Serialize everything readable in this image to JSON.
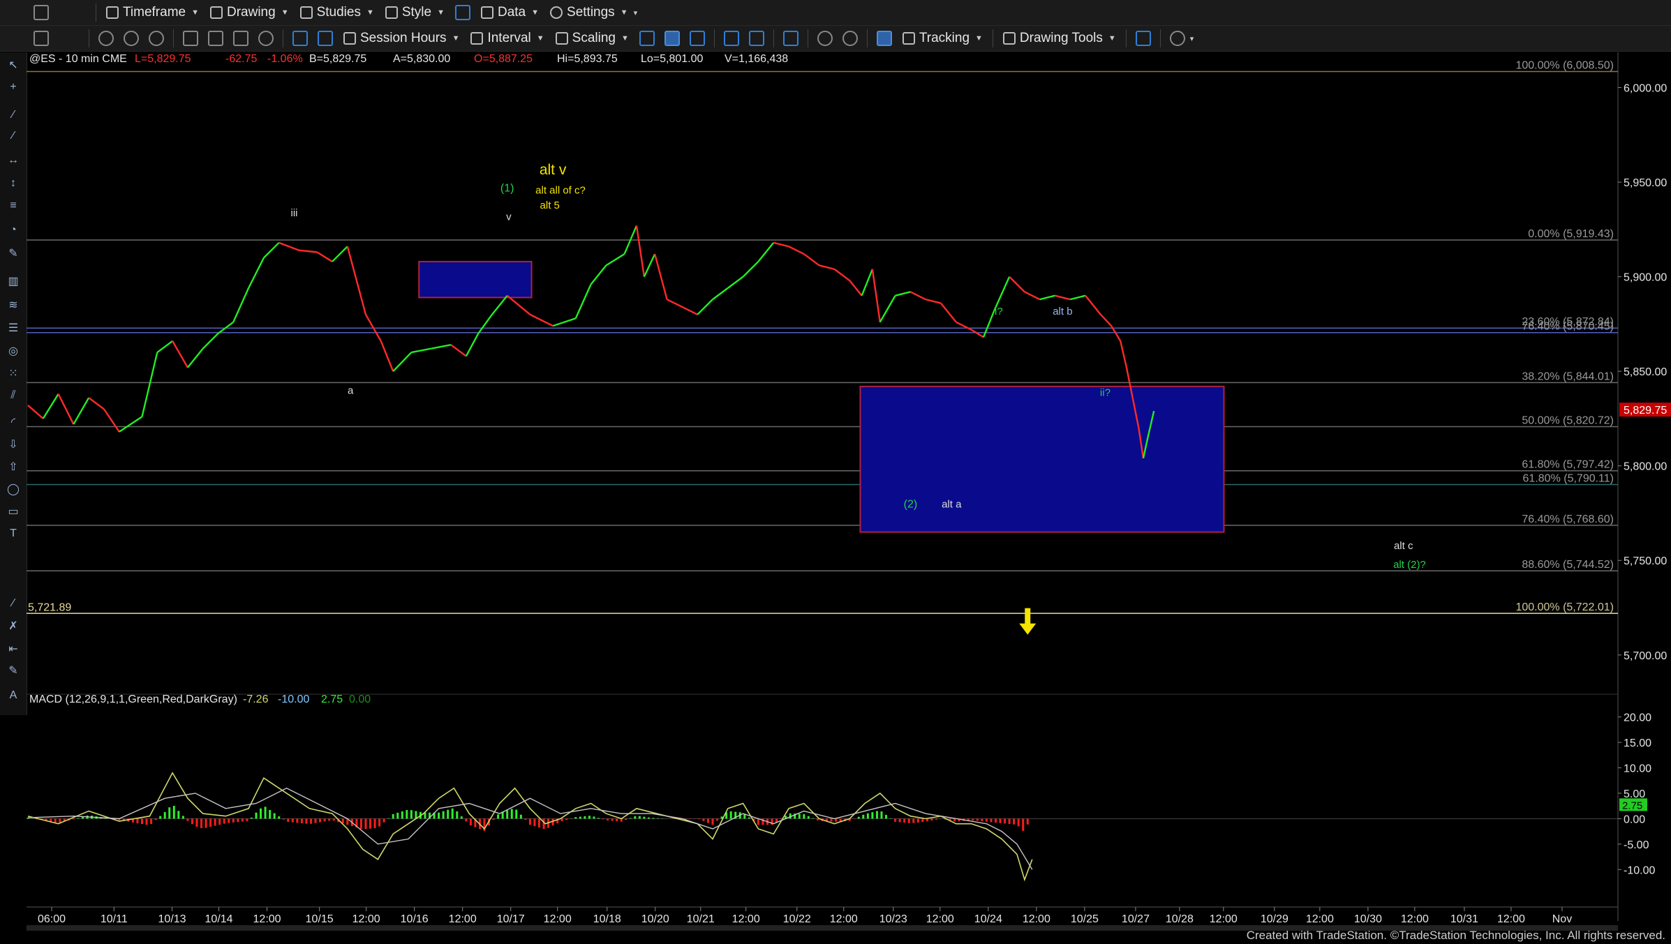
{
  "toolbar_top": {
    "items": [
      {
        "label": "Timeframe"
      },
      {
        "label": "Drawing"
      },
      {
        "label": "Studies"
      },
      {
        "label": "Style"
      },
      {
        "label": "Data"
      },
      {
        "label": "Settings"
      }
    ]
  },
  "toolbar_second": {
    "session_hours": "Session Hours",
    "interval": "Interval",
    "scaling": "Scaling",
    "tracking": "Tracking",
    "drawing_tools": "Drawing Tools"
  },
  "status_line": {
    "symbol": "@ES - 10 min  CME",
    "last": "L=5,829.75",
    "net_change": "-62.75",
    "pct_change": "-1.06%",
    "bid": "B=5,829.75",
    "ask": "A=5,830.00",
    "open": "O=5,887.25",
    "high": "Hi=5,893.75",
    "low": "Lo=5,801.00",
    "volume": "V=1,166,438"
  },
  "macd_line": {
    "label": "MACD (12,26,9,1,1,Green,Red,DarkGray)",
    "macd": "-7.26",
    "signal": "-10.00",
    "hist": "2.75",
    "zero": "0.00"
  },
  "colors": {
    "up": "#22ee22",
    "down": "#ff2a2a",
    "price_box": "#0a0a8c",
    "price_box_border": "#b02040",
    "last_price_tag": "#c80000",
    "macd_hist_pos": "#2ef02e",
    "macd_hist_neg": "#ff1c1c",
    "macd_line": "#cfd86a",
    "signal_line": "#c8c8c8",
    "fib_line": "#6a6a6a",
    "yellow": "#f5e400",
    "green_label": "#21d34a",
    "blue_label": "#4a8ff0"
  },
  "chart_data": {
    "type": "candlestick",
    "symbol": "@ES",
    "interval": "10 min",
    "y_axis_price": {
      "ylim": [
        5680,
        6012
      ],
      "ticks": [
        "6,000.00",
        "5,950.00",
        "5,900.00",
        "5,850.00",
        "5,800.00",
        "5,750.00",
        "5,700.00"
      ],
      "tick_values": [
        6000,
        5950,
        5900,
        5850,
        5800,
        5750,
        5700
      ]
    },
    "last_price_tag": {
      "label": "5,829.75",
      "value": 5829.75
    },
    "left_level": {
      "label": "5,721.89",
      "value": 5721.89
    },
    "x_axis": {
      "ticks": [
        "06:00",
        "10/11",
        "10/13",
        "10/14",
        "12:00",
        "10/15",
        "12:00",
        "10/16",
        "12:00",
        "10/17",
        "12:00",
        "10/18",
        "10/20",
        "10/21",
        "12:00",
        "10/22",
        "12:00",
        "10/23",
        "12:00",
        "10/24",
        "12:00",
        "10/25",
        "10/27",
        "10/28",
        "12:00",
        "10/29",
        "12:00",
        "10/30",
        "12:00",
        "10/31",
        "12:00",
        "Nov"
      ],
      "tick_positions": [
        0.0,
        0.044,
        0.085,
        0.118,
        0.152,
        0.189,
        0.222,
        0.256,
        0.29,
        0.324,
        0.357,
        0.392,
        0.426,
        0.458,
        0.49,
        0.526,
        0.559,
        0.594,
        0.627,
        0.661,
        0.695,
        0.729,
        0.765,
        0.796,
        0.827,
        0.863,
        0.895,
        0.929,
        0.962,
        0.997,
        1.03,
        1.066
      ]
    },
    "price_path": [
      [
        0.0,
        5832
      ],
      [
        0.01,
        5825
      ],
      [
        0.02,
        5838
      ],
      [
        0.03,
        5822
      ],
      [
        0.04,
        5836
      ],
      [
        0.05,
        5830
      ],
      [
        0.06,
        5818
      ],
      [
        0.075,
        5826
      ],
      [
        0.085,
        5860
      ],
      [
        0.095,
        5866
      ],
      [
        0.105,
        5852
      ],
      [
        0.115,
        5862
      ],
      [
        0.125,
        5870
      ],
      [
        0.135,
        5876
      ],
      [
        0.145,
        5894
      ],
      [
        0.155,
        5910
      ],
      [
        0.165,
        5918
      ],
      [
        0.178,
        5914
      ],
      [
        0.19,
        5913
      ],
      [
        0.2,
        5908
      ],
      [
        0.21,
        5916
      ],
      [
        0.222,
        5880
      ],
      [
        0.232,
        5866
      ],
      [
        0.24,
        5850
      ],
      [
        0.252,
        5860
      ],
      [
        0.265,
        5862
      ],
      [
        0.278,
        5864
      ],
      [
        0.288,
        5858
      ],
      [
        0.296,
        5870
      ],
      [
        0.305,
        5880
      ],
      [
        0.315,
        5890
      ],
      [
        0.33,
        5880
      ],
      [
        0.345,
        5874
      ],
      [
        0.36,
        5878
      ],
      [
        0.37,
        5896
      ],
      [
        0.38,
        5906
      ],
      [
        0.392,
        5912
      ],
      [
        0.4,
        5927
      ],
      [
        0.405,
        5900
      ],
      [
        0.412,
        5912
      ],
      [
        0.42,
        5888
      ],
      [
        0.43,
        5884
      ],
      [
        0.44,
        5880
      ],
      [
        0.45,
        5888
      ],
      [
        0.46,
        5894
      ],
      [
        0.47,
        5900
      ],
      [
        0.48,
        5908
      ],
      [
        0.49,
        5918
      ],
      [
        0.5,
        5916
      ],
      [
        0.51,
        5912
      ],
      [
        0.52,
        5906
      ],
      [
        0.53,
        5904
      ],
      [
        0.54,
        5898
      ],
      [
        0.548,
        5890
      ],
      [
        0.555,
        5904
      ],
      [
        0.56,
        5876
      ],
      [
        0.57,
        5890
      ],
      [
        0.58,
        5892
      ],
      [
        0.59,
        5888
      ],
      [
        0.6,
        5886
      ],
      [
        0.61,
        5876
      ],
      [
        0.62,
        5872
      ],
      [
        0.628,
        5868
      ],
      [
        0.635,
        5882
      ],
      [
        0.645,
        5900
      ],
      [
        0.655,
        5892
      ],
      [
        0.665,
        5888
      ],
      [
        0.675,
        5890
      ],
      [
        0.685,
        5888
      ],
      [
        0.695,
        5890
      ],
      [
        0.705,
        5880
      ],
      [
        0.712,
        5874
      ],
      [
        0.718,
        5866
      ],
      [
        0.722,
        5852
      ],
      [
        0.726,
        5836
      ],
      [
        0.73,
        5820
      ],
      [
        0.733,
        5804
      ],
      [
        0.736,
        5815
      ],
      [
        0.74,
        5829
      ]
    ],
    "horizontal_levels": [
      {
        "pct": "100.00%",
        "value": 6008.5,
        "label": "100.00% (6,008.50)",
        "color": "#8c7a26"
      },
      {
        "pct": "0.00%",
        "value": 5919.43,
        "label": "0.00% (5,919.43)",
        "color": "#6a6a6a"
      },
      {
        "pct": "23.60%",
        "value": 5872.84,
        "label": "23.60% (5,872.84)",
        "color": "#5560c0"
      },
      {
        "pct": "76.40%",
        "value": 5870.45,
        "label": "76.40% (5,870.45)",
        "color": "#5560c0"
      },
      {
        "pct": "38.20%",
        "value": 5844.01,
        "label": "38.20% (5,844.01)",
        "color": "#6a6a6a"
      },
      {
        "pct": "50.00%",
        "value": 5820.72,
        "label": "50.00% (5,820.72)",
        "color": "#6a6a6a"
      },
      {
        "pct": "61.80%",
        "value": 5797.42,
        "label": "61.80% (5,797.42)",
        "color": "#6a6a6a"
      },
      {
        "pct": "61.80%",
        "value": 5790.11,
        "label": "61.80% (5,790.11)",
        "color": "#2a6a6a"
      },
      {
        "pct": "76.40%",
        "value": 5768.6,
        "label": "76.40% (5,768.60)",
        "color": "#6a6a6a"
      },
      {
        "pct": "88.60%",
        "value": 5744.52,
        "label": "88.60% (5,744.52)",
        "color": "#6a6a6a"
      },
      {
        "pct": "100.00%",
        "value": 5722.01,
        "label": "100.00% (5,722.01)",
        "color": "#e8dd9a"
      }
    ],
    "boxes": [
      {
        "x0": 0.257,
        "x1": 0.331,
        "y0": 5889,
        "y1": 5908
      },
      {
        "x0": 0.547,
        "x1": 0.786,
        "y0": 5765,
        "y1": 5842
      }
    ],
    "annotations": [
      {
        "text": "iii",
        "x": 0.175,
        "y": 5932,
        "color": "#dddddd",
        "size": 15
      },
      {
        "text": "a",
        "x": 0.212,
        "y": 5838,
        "color": "#dddddd",
        "size": 15
      },
      {
        "text": "(1)",
        "x": 0.315,
        "y": 5945,
        "color": "#21d34a",
        "size": 16
      },
      {
        "text": "v",
        "x": 0.316,
        "y": 5930,
        "color": "#dddddd",
        "size": 15
      },
      {
        "text": "alt v",
        "x": 0.345,
        "y": 5954,
        "color": "#f5e400",
        "size": 21
      },
      {
        "text": "alt all of c?",
        "x": 0.35,
        "y": 5944,
        "color": "#f5e400",
        "size": 15
      },
      {
        "text": "alt 5",
        "x": 0.343,
        "y": 5936,
        "color": "#f5e400",
        "size": 15
      },
      {
        "text": "i?",
        "x": 0.638,
        "y": 5880,
        "color": "#21d34a",
        "size": 15
      },
      {
        "text": "alt b",
        "x": 0.68,
        "y": 5880,
        "color": "#9ab7f5",
        "size": 15
      },
      {
        "text": "ii?",
        "x": 0.708,
        "y": 5837,
        "color": "#21d34a",
        "size": 15
      },
      {
        "text": "(2)",
        "x": 0.58,
        "y": 5778,
        "color": "#21d34a",
        "size": 16
      },
      {
        "text": "alt a",
        "x": 0.607,
        "y": 5778,
        "color": "#dddddd",
        "size": 15
      },
      {
        "text": "alt c",
        "x": 0.904,
        "y": 5756,
        "color": "#dddddd",
        "size": 15
      },
      {
        "text": "alt (2)?",
        "x": 0.908,
        "y": 5746,
        "color": "#21d34a",
        "size": 15
      }
    ],
    "arrow": {
      "x": 0.657,
      "y": 5710
    },
    "macd_panel": {
      "ylim": [
        -16,
        22
      ],
      "ticks": [
        "20.00",
        "15.00",
        "10.00",
        "5.00",
        "0.00",
        "-5.00",
        "-10.00"
      ],
      "tick_values": [
        20,
        15,
        10,
        5,
        0,
        -5,
        -10
      ],
      "value_tag": "2.75",
      "macd_path": [
        [
          0.0,
          0.5
        ],
        [
          0.02,
          -1
        ],
        [
          0.04,
          1.5
        ],
        [
          0.06,
          -0.5
        ],
        [
          0.08,
          0.5
        ],
        [
          0.095,
          9
        ],
        [
          0.105,
          4
        ],
        [
          0.115,
          1
        ],
        [
          0.13,
          0.5
        ],
        [
          0.145,
          2
        ],
        [
          0.155,
          8
        ],
        [
          0.17,
          5
        ],
        [
          0.185,
          2
        ],
        [
          0.2,
          1
        ],
        [
          0.21,
          -2
        ],
        [
          0.22,
          -6
        ],
        [
          0.23,
          -8
        ],
        [
          0.24,
          -3
        ],
        [
          0.25,
          -1
        ],
        [
          0.26,
          1
        ],
        [
          0.27,
          4
        ],
        [
          0.28,
          6
        ],
        [
          0.29,
          1
        ],
        [
          0.3,
          -2
        ],
        [
          0.31,
          3
        ],
        [
          0.32,
          6
        ],
        [
          0.33,
          2
        ],
        [
          0.34,
          -1
        ],
        [
          0.35,
          0
        ],
        [
          0.36,
          2
        ],
        [
          0.37,
          3
        ],
        [
          0.38,
          1
        ],
        [
          0.39,
          0
        ],
        [
          0.4,
          2
        ],
        [
          0.42,
          0.5
        ],
        [
          0.44,
          -1
        ],
        [
          0.45,
          -4
        ],
        [
          0.46,
          2
        ],
        [
          0.47,
          3
        ],
        [
          0.48,
          -2
        ],
        [
          0.49,
          -3
        ],
        [
          0.5,
          2
        ],
        [
          0.51,
          3
        ],
        [
          0.52,
          0
        ],
        [
          0.53,
          -1
        ],
        [
          0.54,
          0
        ],
        [
          0.55,
          3
        ],
        [
          0.56,
          5
        ],
        [
          0.57,
          2
        ],
        [
          0.58,
          0.5
        ],
        [
          0.59,
          0
        ],
        [
          0.6,
          0.5
        ],
        [
          0.61,
          -1
        ],
        [
          0.62,
          -1
        ],
        [
          0.63,
          -2
        ],
        [
          0.64,
          -4
        ],
        [
          0.65,
          -7
        ],
        [
          0.655,
          -12
        ],
        [
          0.66,
          -8
        ]
      ],
      "signal_path": [
        [
          0.0,
          0.2
        ],
        [
          0.03,
          0.5
        ],
        [
          0.06,
          0
        ],
        [
          0.09,
          4
        ],
        [
          0.11,
          5
        ],
        [
          0.13,
          2
        ],
        [
          0.15,
          3
        ],
        [
          0.17,
          6
        ],
        [
          0.19,
          3
        ],
        [
          0.21,
          0
        ],
        [
          0.23,
          -5
        ],
        [
          0.25,
          -4
        ],
        [
          0.27,
          2
        ],
        [
          0.29,
          3
        ],
        [
          0.31,
          1
        ],
        [
          0.33,
          4
        ],
        [
          0.35,
          1
        ],
        [
          0.37,
          2
        ],
        [
          0.39,
          1
        ],
        [
          0.41,
          1
        ],
        [
          0.43,
          0
        ],
        [
          0.45,
          -2
        ],
        [
          0.47,
          1
        ],
        [
          0.49,
          -1
        ],
        [
          0.51,
          1.5
        ],
        [
          0.53,
          0
        ],
        [
          0.55,
          1.5
        ],
        [
          0.57,
          3
        ],
        [
          0.59,
          1
        ],
        [
          0.61,
          0
        ],
        [
          0.63,
          -1
        ],
        [
          0.64,
          -2.5
        ],
        [
          0.65,
          -5
        ],
        [
          0.66,
          -10
        ]
      ]
    }
  },
  "footer": "Created with TradeStation. ©TradeStation Technologies, Inc. All rights reserved."
}
